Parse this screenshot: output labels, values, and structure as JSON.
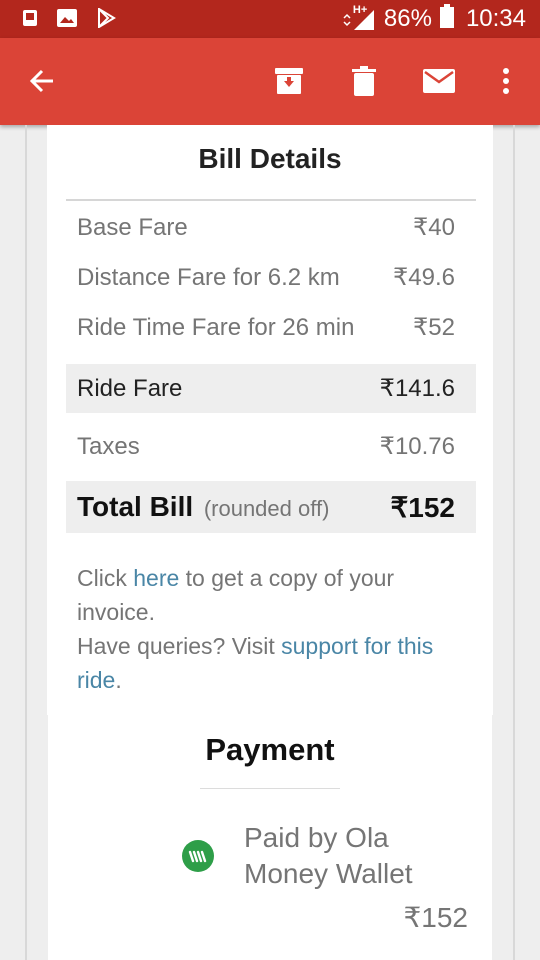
{
  "status_bar": {
    "network": "H+",
    "battery": "86%",
    "time": "10:34"
  },
  "bill": {
    "title": "Bill Details",
    "rows": [
      {
        "label": "Base Fare",
        "value": "₹40"
      },
      {
        "label": "Distance Fare for 6.2 km",
        "value": "₹49.6"
      },
      {
        "label": "Ride Time Fare for 26 min",
        "value": "₹52"
      }
    ],
    "ride_fare": {
      "label": "Ride Fare",
      "value": "₹141.6"
    },
    "taxes": {
      "label": "Taxes",
      "value": "₹10.76"
    },
    "total": {
      "label": "Total Bill",
      "sublabel": "(rounded off)",
      "value": "₹152"
    },
    "invoice_note": {
      "pre": "Click ",
      "link": "here",
      "post": " to get a copy of your invoice."
    },
    "support_note": {
      "pre": "Have queries? Visit ",
      "link": "support for this ride",
      "post": "."
    }
  },
  "payment": {
    "title": "Payment",
    "method": "Paid by Ola Money Wallet",
    "amount": "₹152",
    "wallet_color": "#2e9e48"
  },
  "colors": {
    "app_bar": "#db4437",
    "status_bar": "#b3271d",
    "link": "#4a86a6"
  }
}
